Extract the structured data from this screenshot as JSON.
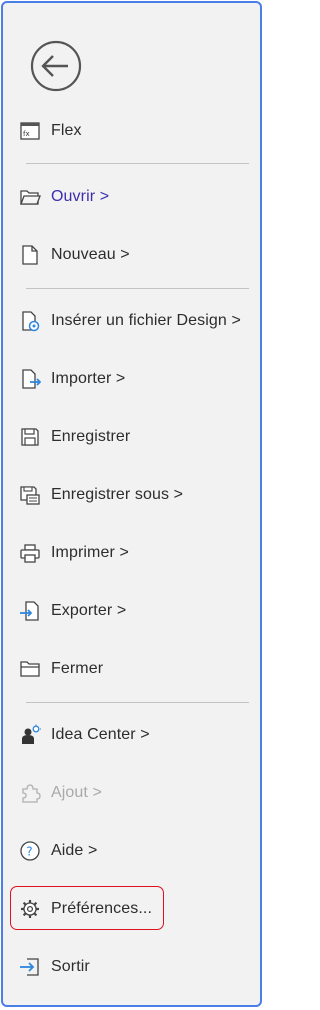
{
  "back": {
    "icon": "back-arrow-icon"
  },
  "menu": {
    "flex": {
      "label": "Flex",
      "icon": "window-icon"
    },
    "ouvrir": {
      "label": "Ouvrir >",
      "icon": "folder-open-icon"
    },
    "nouveau": {
      "label": "Nouveau >",
      "icon": "new-document-icon"
    },
    "inserer": {
      "label": "Insérer un fichier Design >",
      "icon": "insert-design-icon"
    },
    "importer": {
      "label": "Importer >",
      "icon": "import-icon"
    },
    "enregistrer": {
      "label": "Enregistrer",
      "icon": "save-icon"
    },
    "enregistrer_sous": {
      "label": "Enregistrer sous >",
      "icon": "save-as-icon"
    },
    "imprimer": {
      "label": "Imprimer >",
      "icon": "printer-icon"
    },
    "exporter": {
      "label": "Exporter >",
      "icon": "export-icon"
    },
    "fermer": {
      "label": "Fermer",
      "icon": "folder-close-icon"
    },
    "idea_center": {
      "label": "Idea Center >",
      "icon": "idea-center-icon"
    },
    "ajout": {
      "label": "Ajout >",
      "icon": "puzzle-icon"
    },
    "aide": {
      "label": "Aide >",
      "icon": "help-icon"
    },
    "preferences": {
      "label": "Préférences...",
      "icon": "gear-icon"
    },
    "sortir": {
      "label": "Sortir",
      "icon": "exit-icon"
    }
  },
  "colors": {
    "border": "#4a7ee8",
    "background": "#f2f2f2",
    "active_text": "#3a2fb0",
    "disabled_text": "#a9a9a9",
    "highlight": "#e0101e",
    "icon_accent": "#2e86de"
  }
}
